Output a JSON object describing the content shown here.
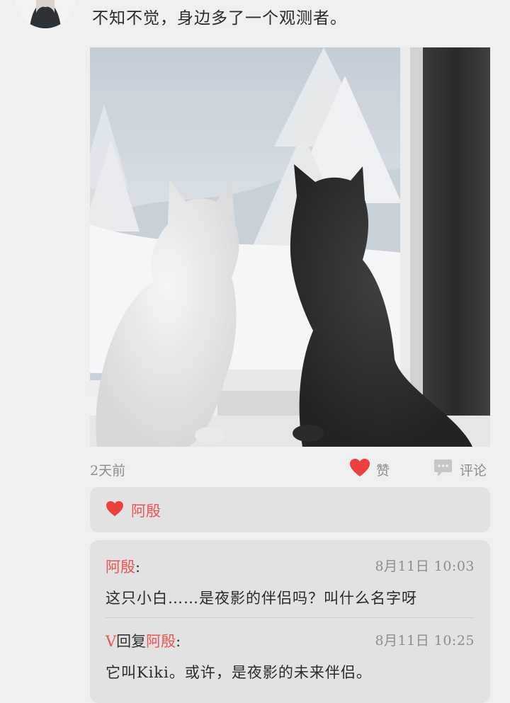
{
  "post": {
    "text": "不知不觉，身边多了一个观测者。",
    "time": "2天前",
    "like_label": "赞",
    "comment_label": "评论"
  },
  "likes": {
    "names": "阿殷"
  },
  "comments": [
    {
      "author": "阿殷",
      "reply_word": "",
      "reply_to": "",
      "date": "8月11日  10:03",
      "text": "这只小白……是夜影的伴侣吗？叫什么名字呀"
    },
    {
      "author": "V",
      "reply_word": "回复",
      "reply_to": "阿殷",
      "date": "8月11日  10:25",
      "text": "它叫Kiki。或许，是夜影的未来伴侣。"
    }
  ],
  "colors": {
    "accent": "#ea5454",
    "background": "#efefef",
    "panel": "#e2e2e2"
  },
  "icons": [
    "heart-icon",
    "comment-bubble-icon"
  ]
}
